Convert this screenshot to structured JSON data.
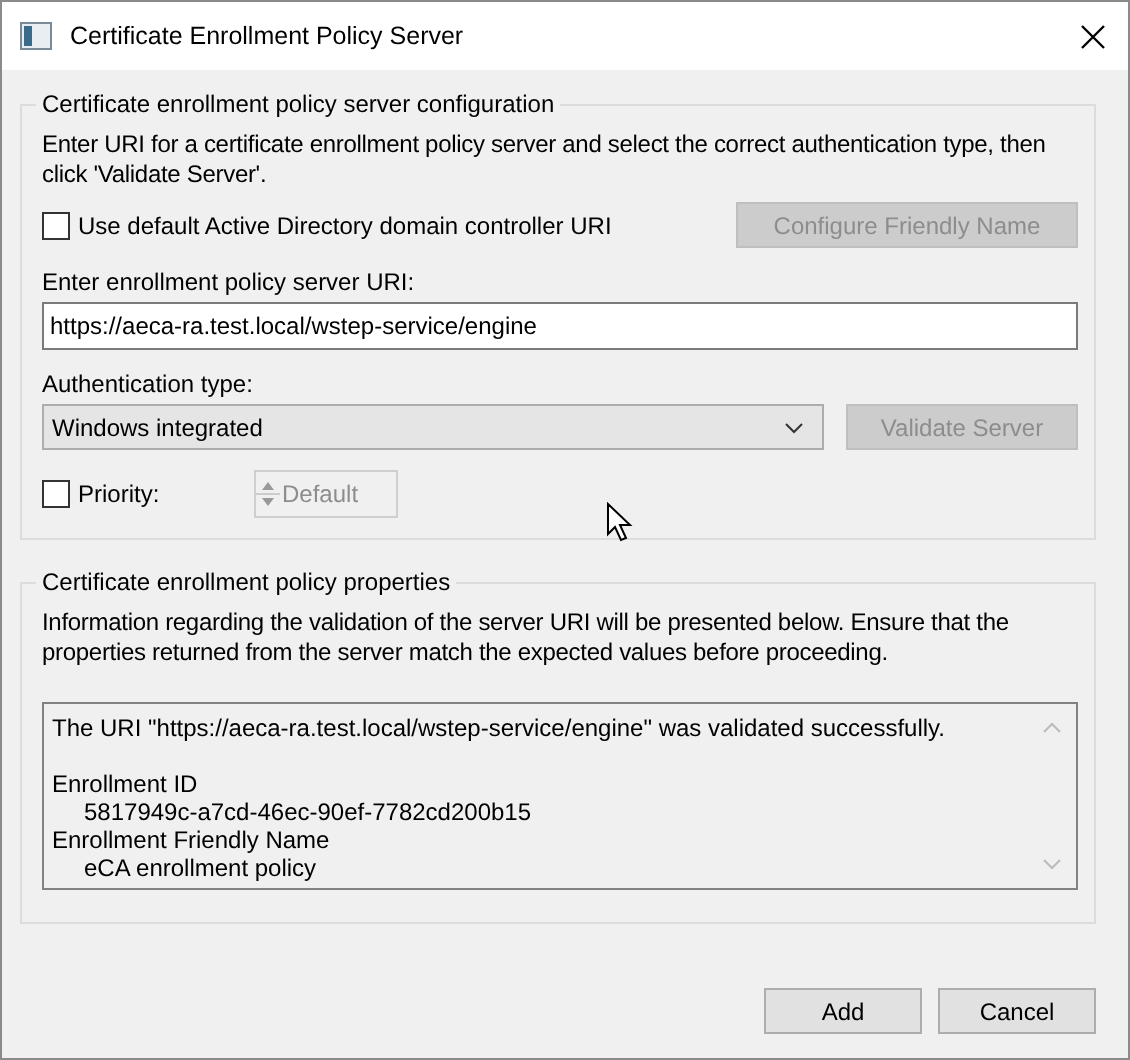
{
  "window": {
    "title": "Certificate Enrollment Policy Server"
  },
  "configuration": {
    "title": "Certificate enrollment policy server configuration",
    "instructions": "Enter URI for a certificate enrollment policy server and select the correct authentication type, then click 'Validate Server'.",
    "use_default_dc": {
      "label": "Use default Active Directory domain controller URI",
      "checked": false
    },
    "configure_button": {
      "label": "Configure Friendly Name",
      "disabled": true
    },
    "uri_label": "Enter enrollment policy server URI:",
    "uri_value": "https://aeca-ra.test.local/wstep-service/engine",
    "auth_label": "Authentication type:",
    "auth_value": "Windows integrated",
    "validate_button": {
      "label": "Validate Server",
      "disabled": true
    },
    "priority": {
      "label": "Priority:",
      "checked": false
    },
    "priority_spinner": {
      "value": "Default",
      "disabled": true
    }
  },
  "properties": {
    "title": "Certificate enrollment policy properties",
    "instructions": "Information regarding the validation of the server URI will be presented below. Ensure that the properties returned from the server match the expected values before proceeding.",
    "output": [
      {
        "kind": "message",
        "text": "The URI \"https://aeca-ra.test.local/wstep-service/engine\" was validated successfully."
      },
      {
        "kind": "heading",
        "text": "Enrollment ID"
      },
      {
        "kind": "value",
        "text": "5817949c-a7cd-46ec-90ef-7782cd200b15"
      },
      {
        "kind": "heading",
        "text": "Enrollment Friendly Name"
      },
      {
        "kind": "value",
        "text": "eCA enrollment policy"
      }
    ]
  },
  "buttons": [
    {
      "label": "Add"
    },
    {
      "label": "Cancel"
    }
  ]
}
